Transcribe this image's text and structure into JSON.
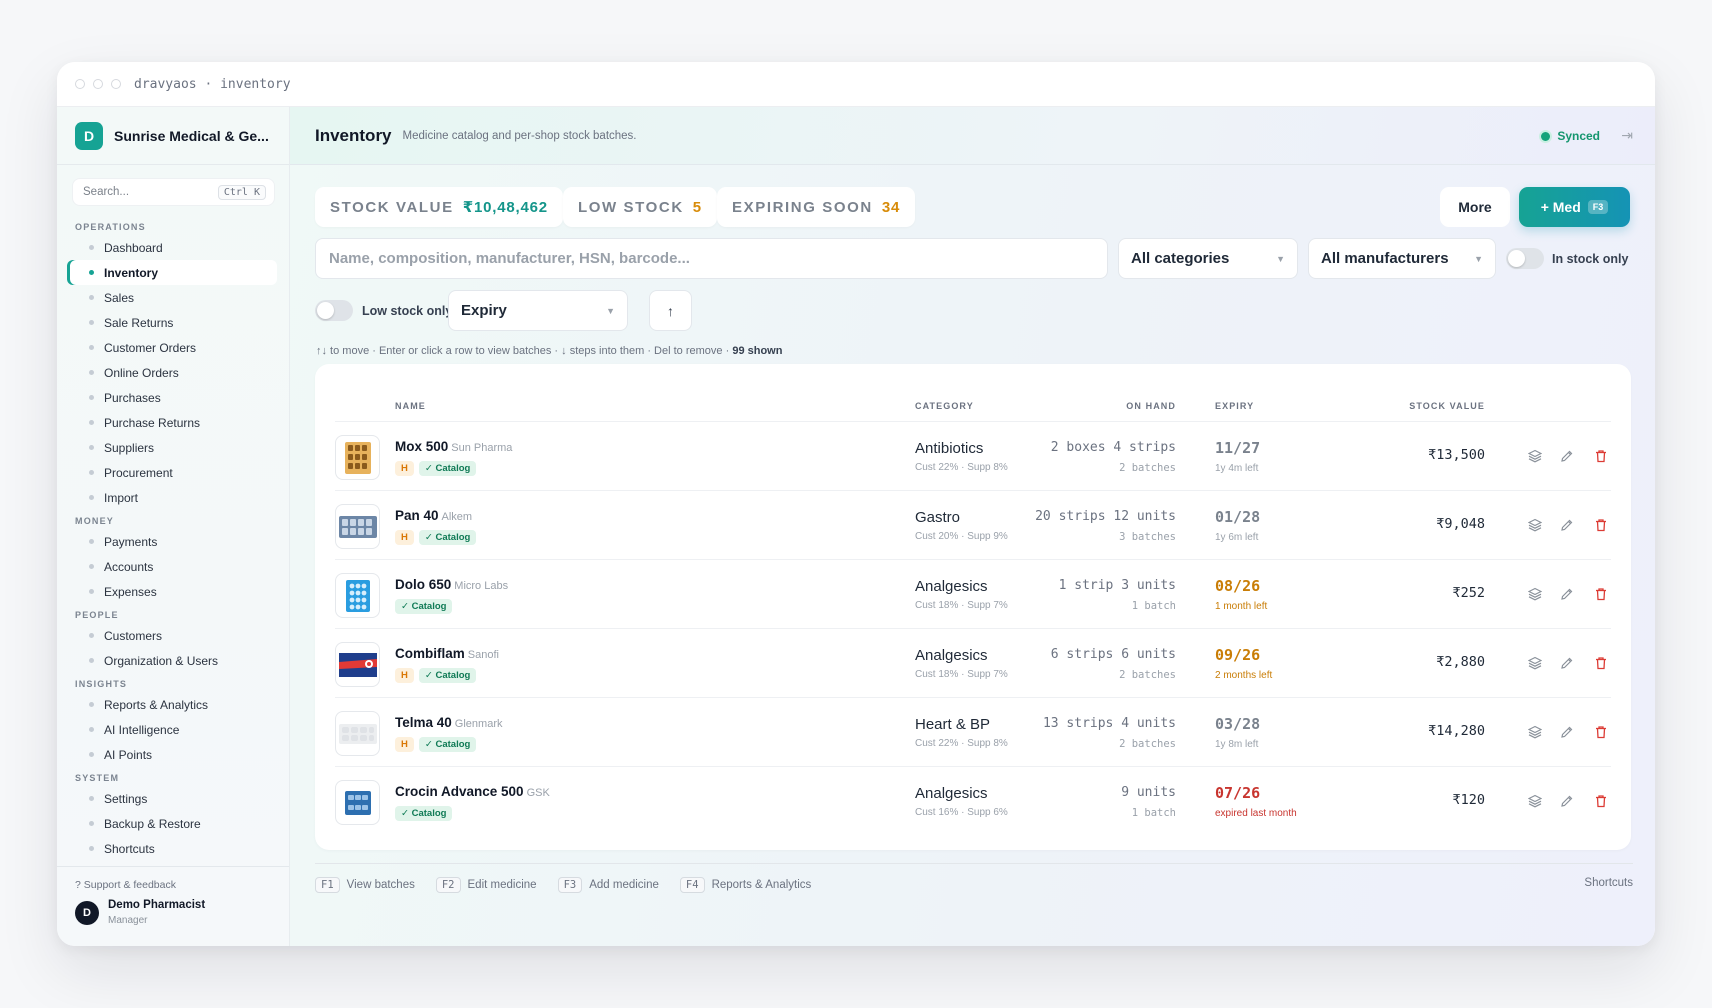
{
  "window": {
    "title": "dravyaos · inventory"
  },
  "brand": {
    "initial": "D",
    "name": "Sunrise Medical & Ge..."
  },
  "sidebar": {
    "search_placeholder": "Search...",
    "search_shortcut": "Ctrl K",
    "sections": {
      "operations": "OPERATIONS",
      "money": "MONEY",
      "people": "PEOPLE",
      "insights": "INSIGHTS",
      "system": "SYSTEM"
    },
    "items": {
      "dashboard": "Dashboard",
      "inventory": "Inventory",
      "sales": "Sales",
      "sale_returns": "Sale Returns",
      "customer_orders": "Customer Orders",
      "online_orders": "Online Orders",
      "purchases": "Purchases",
      "purchase_returns": "Purchase Returns",
      "suppliers": "Suppliers",
      "procurement": "Procurement",
      "import": "Import",
      "payments": "Payments",
      "accounts": "Accounts",
      "expenses": "Expenses",
      "customers": "Customers",
      "org_users": "Organization & Users",
      "reports": "Reports & Analytics",
      "ai_intel": "AI Intelligence",
      "ai_points": "AI Points",
      "settings": "Settings",
      "backup": "Backup & Restore",
      "shortcuts": "Shortcuts"
    },
    "support": "? Support & feedback",
    "user": {
      "initial": "D",
      "name": "Demo Pharmacist",
      "role": "Manager"
    }
  },
  "header": {
    "title": "Inventory",
    "subtitle": "Medicine catalog and per-shop stock batches.",
    "sync_status": "Synced"
  },
  "stats": {
    "stock_value_label": "STOCK VALUE",
    "stock_value": "₹10,48,462",
    "low_stock_label": "LOW STOCK",
    "low_stock": "5",
    "expiring_label": "EXPIRING SOON",
    "expiring": "34"
  },
  "actions": {
    "more": "More",
    "add_med": "+ Med",
    "add_med_key": "F3"
  },
  "filters": {
    "search_placeholder": "Name, composition, manufacturer, HSN, barcode...",
    "category": "All categories",
    "manufacturer": "All manufacturers",
    "in_stock_only": "In stock only",
    "low_stock_only": "Low stock only",
    "sort_by": "Expiry",
    "sort_dir": "↑"
  },
  "hint": {
    "text": "↑↓ to move · Enter or click a row to view batches · ↓ steps into them · Del to remove ·",
    "shown": "99 shown"
  },
  "table": {
    "headers": {
      "name": "NAME",
      "category": "CATEGORY",
      "on_hand": "ON HAND",
      "expiry": "EXPIRY",
      "stock_value": "STOCK VALUE"
    },
    "rows": [
      {
        "name": "Mox 500",
        "mfr": "Sun Pharma",
        "h": "H",
        "catalog": "✓ Catalog",
        "category": "Antibiotics",
        "tax": "Cust 22% · Supp 8%",
        "on_hand": "2 boxes 4 strips",
        "batches": "2 batches",
        "expiry": "11/27",
        "expiry_note": "1y 4m left",
        "value": "₹13,500"
      },
      {
        "name": "Pan 40",
        "mfr": "Alkem",
        "h": "H",
        "catalog": "✓ Catalog",
        "category": "Gastro",
        "tax": "Cust 20% · Supp 9%",
        "on_hand": "20 strips 12 units",
        "batches": "3 batches",
        "expiry": "01/28",
        "expiry_note": "1y 6m left",
        "value": "₹9,048"
      },
      {
        "name": "Dolo 650",
        "mfr": "Micro Labs",
        "h": "",
        "catalog": "✓ Catalog",
        "category": "Analgesics",
        "tax": "Cust 18% · Supp 7%",
        "on_hand": "1 strip 3 units",
        "batches": "1 batch",
        "expiry": "08/26",
        "expiry_note": "1 month left",
        "value": "₹252"
      },
      {
        "name": "Combiflam",
        "mfr": "Sanofi",
        "h": "H",
        "catalog": "✓ Catalog",
        "category": "Analgesics",
        "tax": "Cust 18% · Supp 7%",
        "on_hand": "6 strips 6 units",
        "batches": "2 batches",
        "expiry": "09/26",
        "expiry_note": "2 months left",
        "value": "₹2,880"
      },
      {
        "name": "Telma 40",
        "mfr": "Glenmark",
        "h": "H",
        "catalog": "✓ Catalog",
        "category": "Heart & BP",
        "tax": "Cust 22% · Supp 8%",
        "on_hand": "13 strips 4 units",
        "batches": "2 batches",
        "expiry": "03/28",
        "expiry_note": "1y 8m left",
        "value": "₹14,280"
      },
      {
        "name": "Crocin Advance 500",
        "mfr": "GSK",
        "h": "",
        "catalog": "✓ Catalog",
        "category": "Analgesics",
        "tax": "Cust 16% · Supp 6%",
        "on_hand": "9 units",
        "batches": "1 batch",
        "expiry": "07/26",
        "expiry_note": "expired last month",
        "value": "₹120"
      }
    ]
  },
  "footer": {
    "f1": "F1",
    "f1_label": "View batches",
    "f2": "F2",
    "f2_label": "Edit medicine",
    "f3": "F3",
    "f3_label": "Add medicine",
    "f4": "F4",
    "f4_label": "Reports & Analytics",
    "shortcuts": "Shortcuts"
  },
  "colors": {
    "accent": "#16a394",
    "warning": "#c97d06",
    "danger": "#c8352f"
  }
}
